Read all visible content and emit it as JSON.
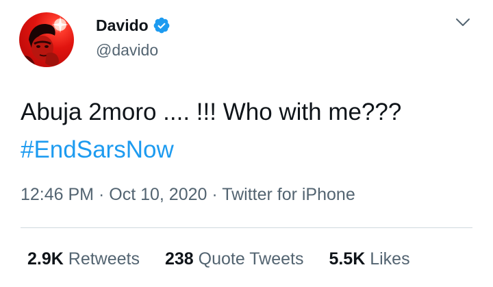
{
  "author": {
    "name": "Davido",
    "handle": "@davido"
  },
  "tweet": {
    "text": "Abuja 2moro .... !!! Who with me???",
    "hashtag": "#EndSarsNow"
  },
  "meta": {
    "time": "12:46 PM",
    "separator": "·",
    "date": "Oct 10, 2020",
    "source": "Twitter for iPhone"
  },
  "stats": {
    "retweets_count": "2.9K",
    "retweets_label": "Retweets",
    "quote_count": "238",
    "quote_label": "Quote Tweets",
    "likes_count": "5.5K",
    "likes_label": "Likes"
  },
  "colors": {
    "accent": "#1d9bf0",
    "verified_badge": "#1d9bf0",
    "muted_text": "#536471",
    "avatar_background": "#e0140f"
  },
  "icons": {
    "verified": "verified-badge-icon",
    "more": "chevron-down-icon"
  }
}
